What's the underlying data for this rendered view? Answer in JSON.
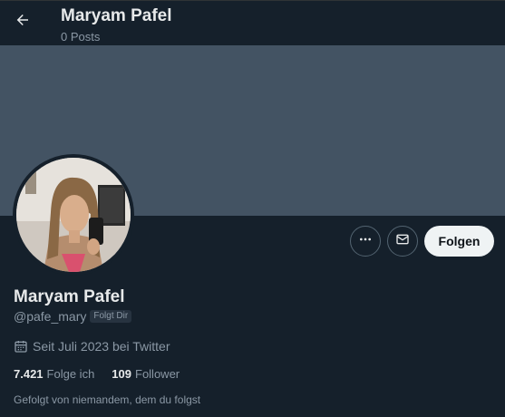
{
  "header": {
    "title": "Maryam Pafel",
    "post_count": "0 Posts"
  },
  "profile": {
    "display_name": "Maryam Pafel",
    "handle": "@pafe_mary",
    "follows_you": "Folgt Dir",
    "joined": "Seit Juli 2023 bei Twitter",
    "following_count": "7.421",
    "following_label": "Folge ich",
    "followers_count": "109",
    "followers_label": "Follower",
    "followed_by": "Gefolgt von niemandem, dem du folgst"
  },
  "actions": {
    "more_icon": "more-horizontal-icon",
    "message_icon": "envelope-icon",
    "follow_label": "Folgen"
  },
  "icons": {
    "back": "arrow-left-icon",
    "calendar": "calendar-icon"
  },
  "colors": {
    "background": "#15202b",
    "banner": "#435363",
    "text_primary": "#e7e9ea",
    "text_secondary": "#8b98a5",
    "follow_button_bg": "#eff3f4"
  }
}
